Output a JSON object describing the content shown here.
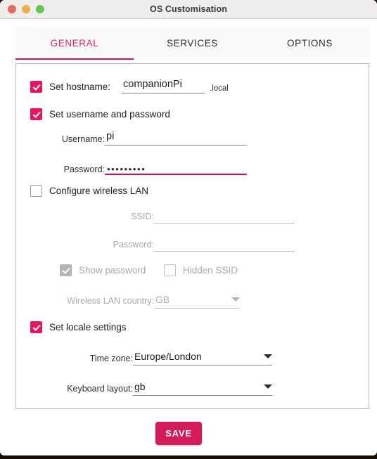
{
  "window": {
    "title": "OS Customisation",
    "traffic_lights": [
      "close-red",
      "minimize-yellow",
      "zoom-green"
    ]
  },
  "tabs": [
    {
      "label": "GENERAL",
      "active": true
    },
    {
      "label": "SERVICES",
      "active": false
    },
    {
      "label": "OPTIONS",
      "active": false
    }
  ],
  "general": {
    "hostname": {
      "checkbox_label": "Set hostname:",
      "checked": true,
      "value": "companionPi",
      "placeholder": "",
      "suffix": ".local"
    },
    "user": {
      "checkbox_label": "Set username and password",
      "checked": true,
      "username_label": "Username:",
      "username_value": "pi",
      "password_label": "Password:",
      "password_masked": "•••••••••",
      "password_focused": true
    },
    "wireless": {
      "checkbox_label": "Configure wireless LAN",
      "checked": false,
      "enabled": false,
      "ssid_label": "SSID:",
      "ssid_value": "",
      "password_label": "Password:",
      "password_value": "",
      "show_password_label": "Show password",
      "show_password_checked": true,
      "hidden_ssid_label": "Hidden SSID",
      "hidden_ssid_checked": false,
      "country_label": "Wireless LAN country:",
      "country_value": "GB"
    },
    "locale": {
      "checkbox_label": "Set locale settings",
      "checked": true,
      "timezone_label": "Time zone:",
      "timezone_value": "Europe/London",
      "keyboard_label": "Keyboard layout:",
      "keyboard_value": "gb"
    }
  },
  "footer": {
    "save_label": "SAVE"
  },
  "colors": {
    "accent": "#e8175d",
    "accent_dark": "#d1105a",
    "save_bg": "#d21b58",
    "disabled_text": "#a9a9a9"
  }
}
